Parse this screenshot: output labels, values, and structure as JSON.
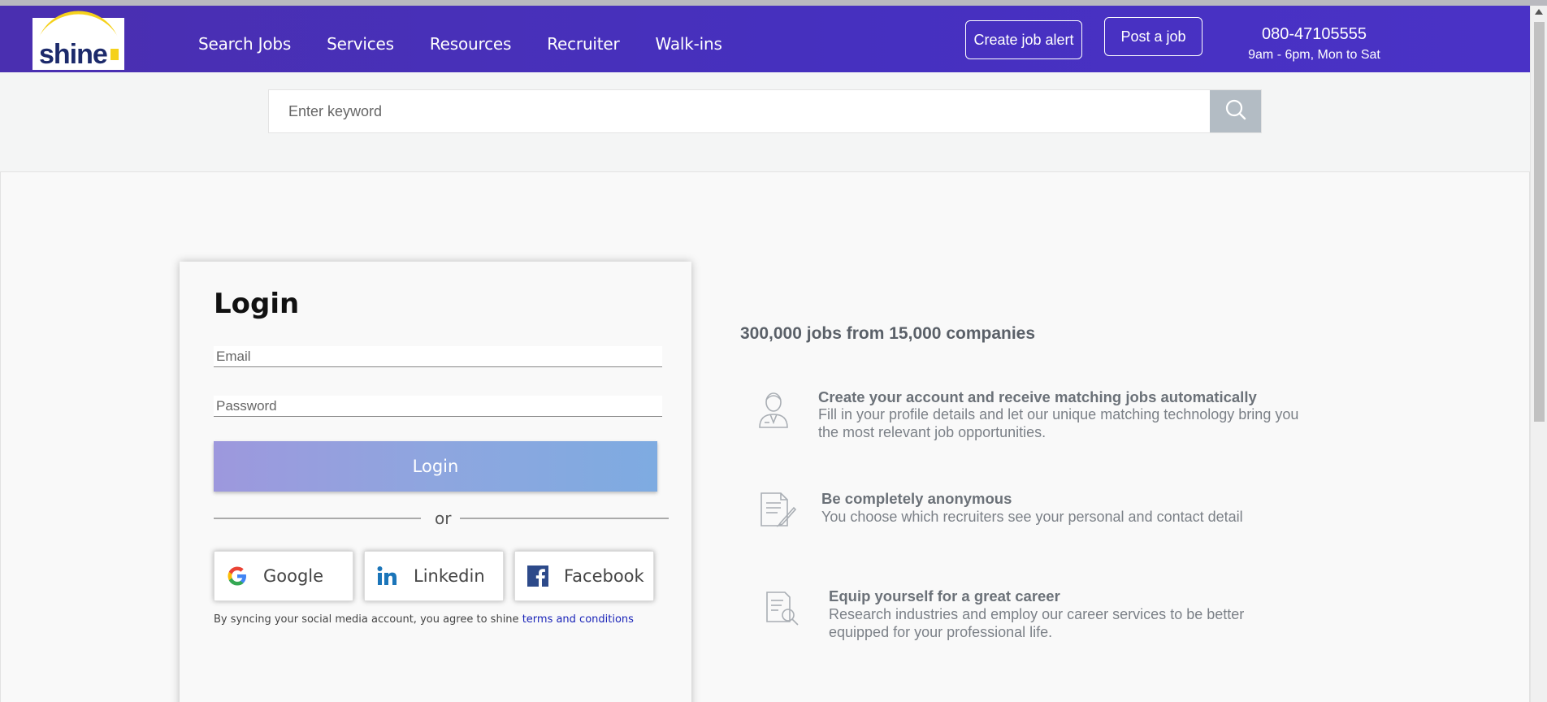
{
  "header": {
    "logo_text": "shine",
    "nav": [
      "Search Jobs",
      "Services",
      "Resources",
      "Recruiter",
      "Walk-ins"
    ],
    "create_alert_label": "Create job alert",
    "post_job_label": "Post a job",
    "phone": "080-47105555",
    "hours": "9am - 6pm, Mon to Sat"
  },
  "search": {
    "placeholder": "Enter keyword"
  },
  "login": {
    "title": "Login",
    "email_placeholder": "Email",
    "password_placeholder": "Password",
    "button_label": "Login",
    "or_text": "or",
    "social": {
      "google": "Google",
      "linkedin": "Linkedin",
      "facebook": "Facebook"
    },
    "terms_text": "By syncing your social media account, you agree to shine",
    "terms_link": "terms and conditions"
  },
  "info": {
    "headline": "300,000 jobs from 15,000 companies",
    "features": [
      {
        "title": "Create your account and receive matching jobs automatically",
        "desc": "Fill in your profile details and let our unique matching technology bring you the most relevant job opportunities.",
        "icon": "user-profile-icon"
      },
      {
        "title": "Be completely anonymous",
        "desc": "You choose which recruiters see your personal and contact detail",
        "icon": "document-edit-icon"
      },
      {
        "title": "Equip yourself for a great career",
        "desc": "Research industries and employ our career services to be better equipped for your professional life.",
        "icon": "document-search-icon"
      }
    ]
  },
  "colors": {
    "header_bg": "#4630bf",
    "login_gradient_start": "#9d98dd",
    "login_gradient_end": "#7eabe1",
    "search_button": "#b3bcc4",
    "logo_yellow": "#f5d11b"
  }
}
